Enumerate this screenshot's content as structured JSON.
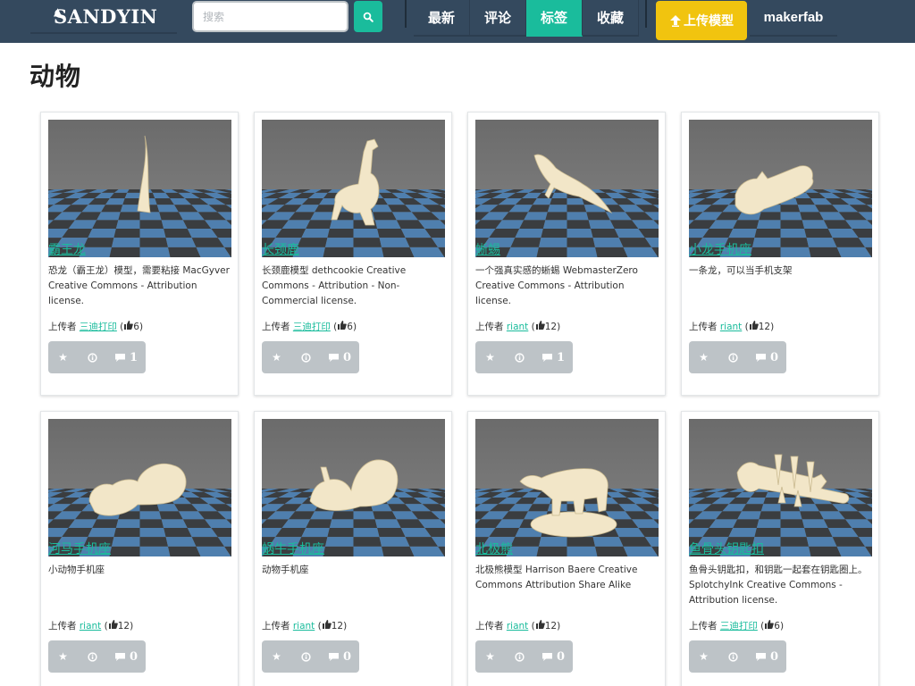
{
  "header": {
    "logo": "SANDYIN",
    "search_placeholder": "搜索",
    "nav": [
      "最新",
      "评论",
      "标签",
      "收藏"
    ],
    "active_nav": "标签",
    "upload_label": "上传模型",
    "username": "makerfab"
  },
  "page": {
    "title": "动物"
  },
  "labels": {
    "uploader": "上传者"
  },
  "models": [
    {
      "name": "霸王龙",
      "desc": "恐龙（霸王龙）模型，需要粘接 MacGyver Creative Commons - Attribution license.",
      "uploader": "三迪打印",
      "likes": "6",
      "comments": "1",
      "model_icon": "horn-model"
    },
    {
      "name": "长颈鹿",
      "desc": "长颈鹿模型 dethcookie Creative Commons - Attribution - Non-Commercial license.",
      "uploader": "三迪打印",
      "likes": "6",
      "comments": "0",
      "model_icon": "giraffe-model"
    },
    {
      "name": "蜥蜴",
      "desc": "一个强真实感的蜥蜴 WebmasterZero Creative Commons - Attribution license.",
      "uploader": "riant",
      "likes": "12",
      "comments": "1",
      "model_icon": "lizard-model"
    },
    {
      "name": "小龙手机座",
      "desc": "一条龙，可以当手机支架",
      "uploader": "riant",
      "likes": "12",
      "comments": "0",
      "model_icon": "dragon-model"
    },
    {
      "name": "河马手机座",
      "desc": "小动物手机座",
      "uploader": "riant",
      "likes": "12",
      "comments": "0",
      "model_icon": "hippo-model"
    },
    {
      "name": "蜗牛手机座",
      "desc": "动物手机座",
      "uploader": "riant",
      "likes": "12",
      "comments": "0",
      "model_icon": "snail-model"
    },
    {
      "name": "北极熊",
      "desc": "北极熊模型 Harrison Baere Creative Commons Attribution Share Alike",
      "uploader": "riant",
      "likes": "12",
      "comments": "0",
      "model_icon": "polar-bear-model"
    },
    {
      "name": "鱼骨头钥匙扣",
      "desc": "鱼骨头钥匙扣，和钥匙一起套在钥匙圈上。 SplotchyInk Creative Commons - Attribution license.",
      "uploader": "三迪打印",
      "likes": "6",
      "comments": "0",
      "model_icon": "fishbone-model"
    }
  ],
  "colors": {
    "header_bg": "#34495e",
    "accent": "#1abc9c",
    "upload": "#f1c40f",
    "action_bar": "#bdc3c7",
    "floor_blue": "#4f7fae",
    "floor_dark": "#3a3d40",
    "model": "#f2e6c8"
  }
}
